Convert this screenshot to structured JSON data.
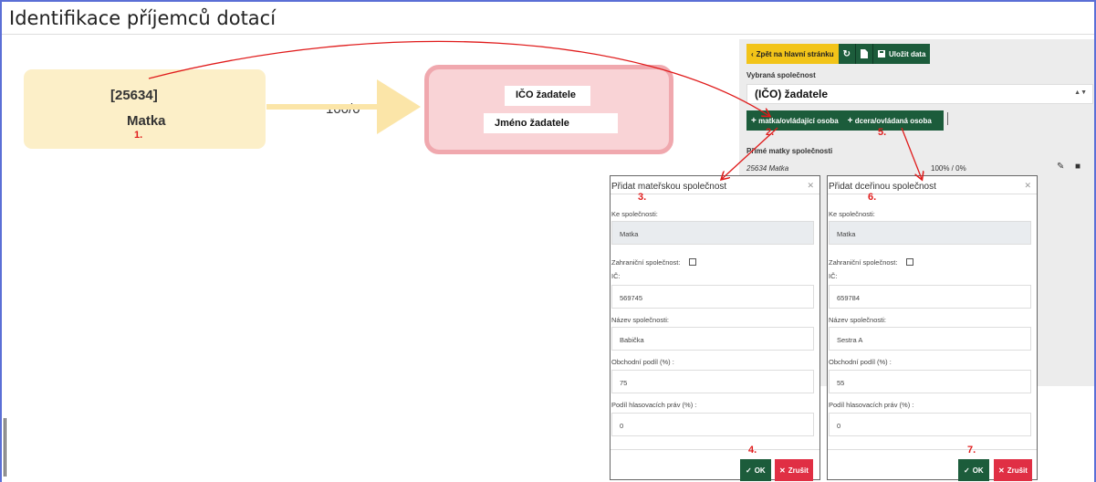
{
  "page": {
    "title": "Identifikace příjemců dotací"
  },
  "diagram": {
    "parent_node": {
      "id": "[25634]",
      "name": "Matka",
      "annotation": "1."
    },
    "edge_label": "100/0",
    "applicant_node": {
      "ico": "IČO žadatele",
      "name": "Jméno žadatele"
    }
  },
  "toolbar": {
    "back_label": "Zpět na hlavní stránku",
    "back_icon": "chevron-left-icon",
    "refresh_icon": "refresh-icon",
    "file_icon": "file-icon",
    "save_label": "Uložit data",
    "save_icon": "save-icon"
  },
  "company": {
    "select_label": "Vybraná společnost",
    "selected_value": "(IČO) žadatele",
    "add_parent_label": "matka/ovládající osoba",
    "add_child_label": "dcera/ovládaná osoba",
    "add_parent_annotation": "2.",
    "add_child_annotation": "5."
  },
  "parents": {
    "heading": "Přímé matky společnosti",
    "rows": [
      {
        "name": "25634 Matka",
        "share": "100% / 0%"
      }
    ]
  },
  "dialog_parent": {
    "title": "Přidat mateřskou společnost",
    "title_annotation": "3.",
    "to_company_label": "Ke společnosti:",
    "to_company_value": "Matka",
    "foreign_label": "Zahraniční společnost:",
    "ic_label": "IČ:",
    "ic_value": "569745",
    "name_label": "Název společnosti:",
    "name_value": "Babička",
    "share_label": "Obchodní podíl (%) :",
    "share_value": "75",
    "votes_label": "Podíl hlasovacích práv (%) :",
    "votes_value": "0",
    "ok_label": "OK",
    "cancel_label": "Zrušit",
    "ok_annotation": "4."
  },
  "dialog_child": {
    "title": "Přidat dceřinou společnost",
    "title_annotation": "6.",
    "to_company_label": "Ke společnosti:",
    "to_company_value": "Matka",
    "foreign_label": "Zahraniční společnost:",
    "ic_label": "IČ:",
    "ic_value": "659784",
    "name_label": "Název společnosti:",
    "name_value": "Sestra A",
    "share_label": "Obchodní podíl (%) :",
    "share_value": "55",
    "votes_label": "Podíl hlasovacích práv (%) :",
    "votes_value": "0",
    "ok_label": "OK",
    "cancel_label": "Zrušit",
    "ok_annotation": "7."
  },
  "colors": {
    "accent_green": "#1c5c3b",
    "warning_yellow": "#f2c419",
    "danger_red": "#e02f44",
    "annotation_red": "#e01b1b"
  }
}
